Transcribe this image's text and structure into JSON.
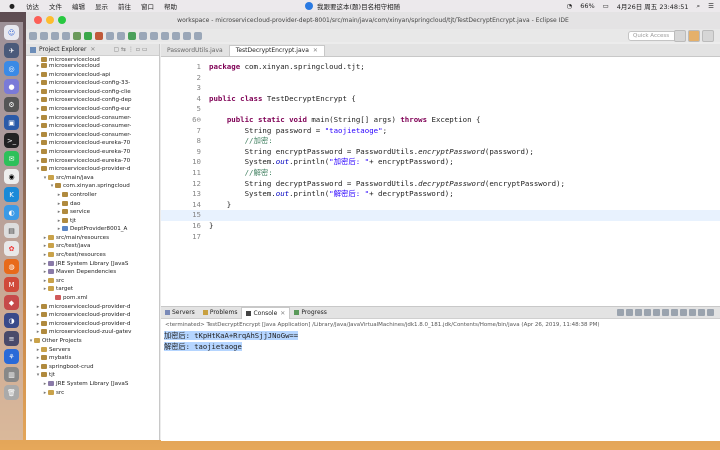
{
  "menubar": {
    "apple": "",
    "items": [
      "访达",
      "文件",
      "编辑",
      "显示",
      "前往",
      "窗口",
      "帮助"
    ],
    "center_text": "我跟要这本(题)目名相守相随",
    "battery": "66%",
    "datetime": "4月26日 周五 23:48:51"
  },
  "window": {
    "title": "workspace - microservicecloud-provider-dept-8001/src/main/java/com/xinyan/springcloud/tjt/TestDecryptEncrypt.java - Eclipse IDE",
    "quick_access": "Quick Access"
  },
  "explorer": {
    "tab_label": "Project Explorer",
    "tab_close": "✕",
    "items": [
      {
        "indent": 1,
        "arrow": "",
        "label": "microservicecloud",
        "color": "#b08a3e",
        "partial": true
      },
      {
        "indent": 1,
        "arrow": "▸",
        "label": "microservicecloud",
        "color": "#b08a3e"
      },
      {
        "indent": 1,
        "arrow": "▸",
        "label": "microservicecloud-api",
        "color": "#b08a3e"
      },
      {
        "indent": 1,
        "arrow": "▸",
        "label": "microservicecloud-config-33-",
        "color": "#b08a3e"
      },
      {
        "indent": 1,
        "arrow": "▸",
        "label": "microservicecloud-config-clie",
        "color": "#b08a3e"
      },
      {
        "indent": 1,
        "arrow": "▸",
        "label": "microservicecloud-config-dep",
        "color": "#b08a3e"
      },
      {
        "indent": 1,
        "arrow": "▸",
        "label": "microservicecloud-config-eur",
        "color": "#b08a3e"
      },
      {
        "indent": 1,
        "arrow": "▸",
        "label": "microservicecloud-consumer-",
        "color": "#b08a3e"
      },
      {
        "indent": 1,
        "arrow": "▸",
        "label": "microservicecloud-consumer-",
        "color": "#b08a3e"
      },
      {
        "indent": 1,
        "arrow": "▸",
        "label": "microservicecloud-consumer-",
        "color": "#b08a3e"
      },
      {
        "indent": 1,
        "arrow": "▸",
        "label": "microservicecloud-eureka-70",
        "color": "#b08a3e"
      },
      {
        "indent": 1,
        "arrow": "▸",
        "label": "microservicecloud-eureka-70",
        "color": "#b08a3e"
      },
      {
        "indent": 1,
        "arrow": "▸",
        "label": "microservicecloud-eureka-70",
        "color": "#b08a3e"
      },
      {
        "indent": 1,
        "arrow": "▾",
        "label": "microservicecloud-provider-d",
        "color": "#b08a3e"
      },
      {
        "indent": 2,
        "arrow": "▾",
        "label": "src/main/java",
        "color": "#c9a24a"
      },
      {
        "indent": 3,
        "arrow": "▾",
        "label": "com.xinyan.springcloud",
        "color": "#b08a3e"
      },
      {
        "indent": 4,
        "arrow": "▸",
        "label": "controller",
        "color": "#b08a3e"
      },
      {
        "indent": 4,
        "arrow": "▸",
        "label": "dao",
        "color": "#b08a3e"
      },
      {
        "indent": 4,
        "arrow": "▸",
        "label": "service",
        "color": "#b08a3e"
      },
      {
        "indent": 4,
        "arrow": "▸",
        "label": "tjt",
        "color": "#b08a3e"
      },
      {
        "indent": 4,
        "arrow": "▸",
        "label": "DeptProvider8001_A",
        "color": "#5b86c5"
      },
      {
        "indent": 2,
        "arrow": "▸",
        "label": "src/main/resources",
        "color": "#c9a24a"
      },
      {
        "indent": 2,
        "arrow": "▸",
        "label": "src/test/java",
        "color": "#c9a24a"
      },
      {
        "indent": 2,
        "arrow": "▸",
        "label": "src/test/resources",
        "color": "#c9a24a"
      },
      {
        "indent": 2,
        "arrow": "▸",
        "label": "JRE System Library [JavaS",
        "color": "#8a7aa8"
      },
      {
        "indent": 2,
        "arrow": "▸",
        "label": "Maven Dependencies",
        "color": "#8a7aa8"
      },
      {
        "indent": 2,
        "arrow": "▸",
        "label": "src",
        "color": "#c9a24a"
      },
      {
        "indent": 2,
        "arrow": "▸",
        "label": "target",
        "color": "#c9a24a"
      },
      {
        "indent": 3,
        "arrow": "",
        "label": "pom.xml",
        "color": "#d05a5a"
      },
      {
        "indent": 1,
        "arrow": "▸",
        "label": "microservicecloud-provider-d",
        "color": "#b08a3e"
      },
      {
        "indent": 1,
        "arrow": "▸",
        "label": "microservicecloud-provider-d",
        "color": "#b08a3e"
      },
      {
        "indent": 1,
        "arrow": "▸",
        "label": "microservicecloud-provider-d",
        "color": "#b08a3e"
      },
      {
        "indent": 1,
        "arrow": "▸",
        "label": "microservicecloud-zuul-gatev",
        "color": "#b08a3e"
      },
      {
        "indent": 0,
        "arrow": "▾",
        "label": "Other Projects",
        "color": "#c9a24a"
      },
      {
        "indent": 1,
        "arrow": "▸",
        "label": "Servers",
        "color": "#c9a24a"
      },
      {
        "indent": 1,
        "arrow": "▸",
        "label": "mybatis",
        "color": "#b08a3e"
      },
      {
        "indent": 1,
        "arrow": "▸",
        "label": "springboot-crud",
        "color": "#b08a3e"
      },
      {
        "indent": 1,
        "arrow": "▾",
        "label": "tjt",
        "color": "#b08a3e"
      },
      {
        "indent": 2,
        "arrow": "▸",
        "label": "JRE System Library [JavaS",
        "color": "#8a7aa8"
      },
      {
        "indent": 2,
        "arrow": "▸",
        "label": "src",
        "color": "#c9a24a"
      }
    ]
  },
  "editor": {
    "tabs": [
      {
        "label": "PasswordUtils.java",
        "active": false
      },
      {
        "label": "TestDecryptEncrypt.java",
        "active": true
      }
    ],
    "tab_close": "✕",
    "lines": [
      {
        "n": "1",
        "html": "<span class='kw'>package</span> com.xinyan.springcloud.tjt;"
      },
      {
        "n": "2",
        "html": ""
      },
      {
        "n": "3",
        "html": ""
      },
      {
        "n": "4",
        "html": "<span class='kw'>public class</span> TestDecryptEncrypt {"
      },
      {
        "n": "5",
        "html": ""
      },
      {
        "n": "6⊖",
        "html": "    <span class='kw'>public static void</span> main(String[] args) <span class='kw'>throws</span> Exception {"
      },
      {
        "n": "7",
        "html": "        String password = <span class='str'>\"taojietaoge\"</span>;"
      },
      {
        "n": "8",
        "html": "        <span class='cm'>//加密:</span>"
      },
      {
        "n": "9",
        "html": "        String encryptPassword = PasswordUtils.<span class='it'>encryptPassword</span>(password);"
      },
      {
        "n": "10",
        "html": "        System.<span class='fld'>out</span>.println(<span class='str'>\"加密后: \"</span>+ encryptPassword);"
      },
      {
        "n": "11",
        "html": "        <span class='cm'>//解密:</span>"
      },
      {
        "n": "12",
        "html": "        String decryptPassword = PasswordUtils.<span class='it'>decryptPassword</span>(encryptPassword);"
      },
      {
        "n": "13",
        "html": "        System.<span class='fld'>out</span>.println(<span class='str'>\"解密后: \"</span>+ decryptPassword);"
      },
      {
        "n": "14",
        "html": "    }"
      },
      {
        "n": "15",
        "html": "",
        "current": true
      },
      {
        "n": "16",
        "html": "}"
      },
      {
        "n": "17",
        "html": ""
      }
    ]
  },
  "console": {
    "tabs": [
      "Servers",
      "Problems",
      "Console",
      "Progress"
    ],
    "active_tab": "Console",
    "terminated_line": "<terminated> TestDecryptEncrypt [Java Application] /Library/Java/JavaVirtualMachines/jdk1.8.0_181.jdk/Contents/Home/bin/java (Apr 26, 2019, 11:48:38 PM)",
    "output": [
      "加密后: tKpHtKaA+RrqAhSjjJNoGw==",
      "解密后: taojietaoge"
    ]
  }
}
